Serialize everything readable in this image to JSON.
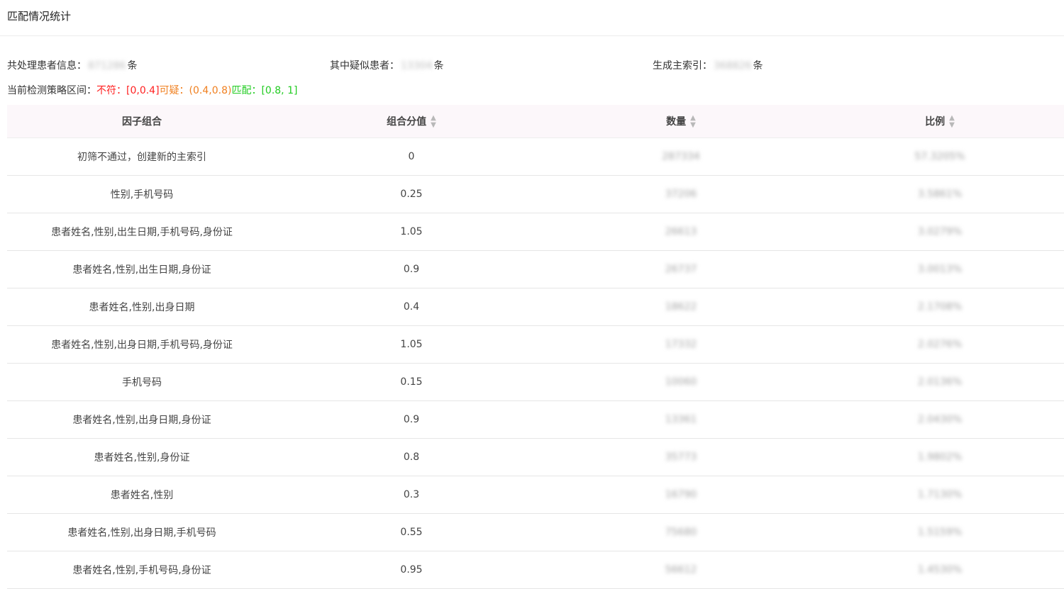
{
  "page": {
    "title": "匹配情况统计"
  },
  "summary": {
    "processed_label": "共处理患者信息：",
    "processed_value": "871286",
    "processed_unit": "条",
    "suspect_label": "其中疑似患者：",
    "suspect_value": "13304",
    "suspect_unit": "条",
    "index_label": "生成主索引：",
    "index_value": "368826",
    "index_unit": "条"
  },
  "strategy": {
    "label": "当前检测策略区间：",
    "mismatch_label": "不符：",
    "mismatch_range": "[0,0.4]",
    "suspect_label": "可疑：",
    "suspect_range": "(0.4,0.8)",
    "match_label": "匹配：",
    "match_range": "[0.8, 1]"
  },
  "colors": {
    "mismatch": "#ff2222",
    "suspect": "#f08020",
    "match": "#22cc22"
  },
  "table": {
    "headers": {
      "combo": "因子组合",
      "score": "组合分值",
      "count": "数量",
      "ratio": "比例"
    },
    "sort_icon": "sort-icon",
    "rows": [
      {
        "combo": "初筛不通过，创建新的主索引",
        "score": "0",
        "count": "287334",
        "ratio": "57.3205%"
      },
      {
        "combo": "性别,手机号码",
        "score": "0.25",
        "count": "37206",
        "ratio": "3.5861%"
      },
      {
        "combo": "患者姓名,性别,出生日期,手机号码,身份证",
        "score": "1.05",
        "count": "26613",
        "ratio": "3.0279%"
      },
      {
        "combo": "患者姓名,性别,出生日期,身份证",
        "score": "0.9",
        "count": "26737",
        "ratio": "3.0013%"
      },
      {
        "combo": "患者姓名,性别,出身日期",
        "score": "0.4",
        "count": "18622",
        "ratio": "2.1708%"
      },
      {
        "combo": "患者姓名,性别,出身日期,手机号码,身份证",
        "score": "1.05",
        "count": "17332",
        "ratio": "2.0276%"
      },
      {
        "combo": "手机号码",
        "score": "0.15",
        "count": "10060",
        "ratio": "2.0136%"
      },
      {
        "combo": "患者姓名,性别,出身日期,身份证",
        "score": "0.9",
        "count": "13361",
        "ratio": "2.0430%"
      },
      {
        "combo": "患者姓名,性别,身份证",
        "score": "0.8",
        "count": "35773",
        "ratio": "1.9802%"
      },
      {
        "combo": "患者姓名,性别",
        "score": "0.3",
        "count": "16790",
        "ratio": "1.7130%"
      },
      {
        "combo": "患者姓名,性别,出身日期,手机号码",
        "score": "0.55",
        "count": "75680",
        "ratio": "1.5159%"
      },
      {
        "combo": "患者姓名,性别,手机号码,身份证",
        "score": "0.95",
        "count": "56612",
        "ratio": "1.4530%"
      }
    ]
  }
}
